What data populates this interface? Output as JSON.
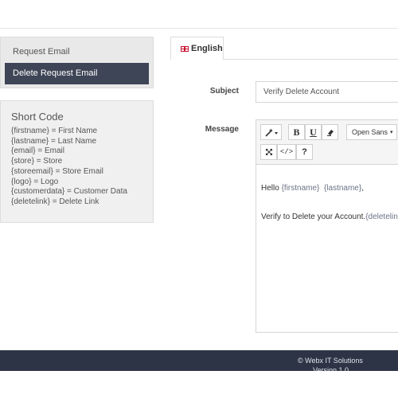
{
  "sidebar": {
    "items": [
      {
        "label": "Request Email"
      },
      {
        "label": "Delete Request Email"
      }
    ]
  },
  "shortcode": {
    "title": "Short Code",
    "lines": [
      "{firstname} = First Name",
      "{lastname} = Last Name",
      "{email} = Email",
      "{store} = Store",
      "{storeemail} = Store Email",
      "{logo} = Logo",
      "{customerdata} = Customer Data",
      "{deletelink} = Delete Link"
    ]
  },
  "tabs": [
    {
      "label": "English",
      "icon": "uk-flag-icon"
    }
  ],
  "form": {
    "subject_label": "Subject",
    "subject_value": "Verify Delete Account",
    "message_label": "Message"
  },
  "editor": {
    "toolbar": {
      "style_icon": "magic-wand-icon",
      "bold": "B",
      "underline": "U",
      "eraser_icon": "eraser-icon",
      "font": "Open Sans",
      "fullscreen_icon": "fullscreen-icon",
      "code_label": "</>",
      "help_label": "?"
    },
    "line1": {
      "prefix": "Hello ",
      "token1": "{firstname}",
      "sep": "  ",
      "token2": "{lastname}",
      "suffix": ","
    },
    "line2": {
      "prefix": "Verify to Delete your Account.",
      "token": "{deletelink}"
    }
  },
  "footer": {
    "copyright": "© Webx IT Solutions",
    "version": "Version 1.0"
  },
  "colors": {
    "active_menu": "#3e4556",
    "footer_bg": "#2d3445",
    "token": "#6a7386"
  }
}
